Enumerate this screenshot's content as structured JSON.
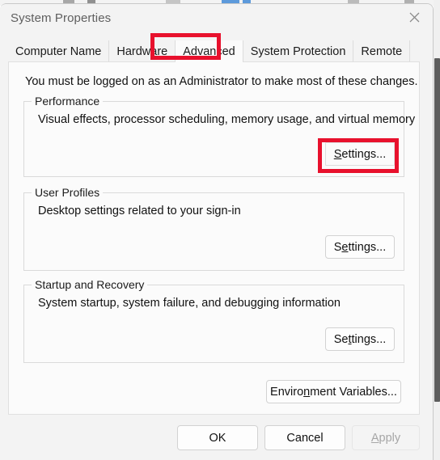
{
  "window": {
    "title": "System Properties",
    "close_icon": "close-icon"
  },
  "tabs": [
    {
      "label": "Computer Name",
      "selected": false
    },
    {
      "label": "Hardware",
      "selected": false
    },
    {
      "label": "Advanced",
      "selected": true
    },
    {
      "label": "System Protection",
      "selected": false
    },
    {
      "label": "Remote",
      "selected": false
    }
  ],
  "content": {
    "admin_notice": "You must be logged on as an Administrator to make most of these changes.",
    "groups": [
      {
        "legend": "Performance",
        "description": "Visual effects, processor scheduling, memory usage, and virtual memory",
        "button": {
          "prefix": "",
          "accel": "S",
          "suffix": "ettings..."
        }
      },
      {
        "legend": "User Profiles",
        "description": "Desktop settings related to your sign-in",
        "button": {
          "prefix": "S",
          "accel": "e",
          "suffix": "ttings..."
        }
      },
      {
        "legend": "Startup and Recovery",
        "description": "System startup, system failure, and debugging information",
        "button": {
          "prefix": "Se",
          "accel": "t",
          "suffix": "tings..."
        }
      }
    ],
    "environment_button": {
      "prefix": "Enviro",
      "accel": "n",
      "suffix": "ment Variables..."
    }
  },
  "footer": {
    "ok": {
      "label": "OK",
      "disabled": false
    },
    "cancel": {
      "label": "Cancel",
      "disabled": false
    },
    "apply": {
      "prefix": "",
      "accel": "A",
      "suffix": "pply",
      "disabled": true
    }
  },
  "colors": {
    "highlight": "#e8112d",
    "dialog_bg": "#f3f3f3",
    "panel_bg": "#fbfbfb",
    "text": "#111111",
    "title_text": "#5f5f5f"
  }
}
